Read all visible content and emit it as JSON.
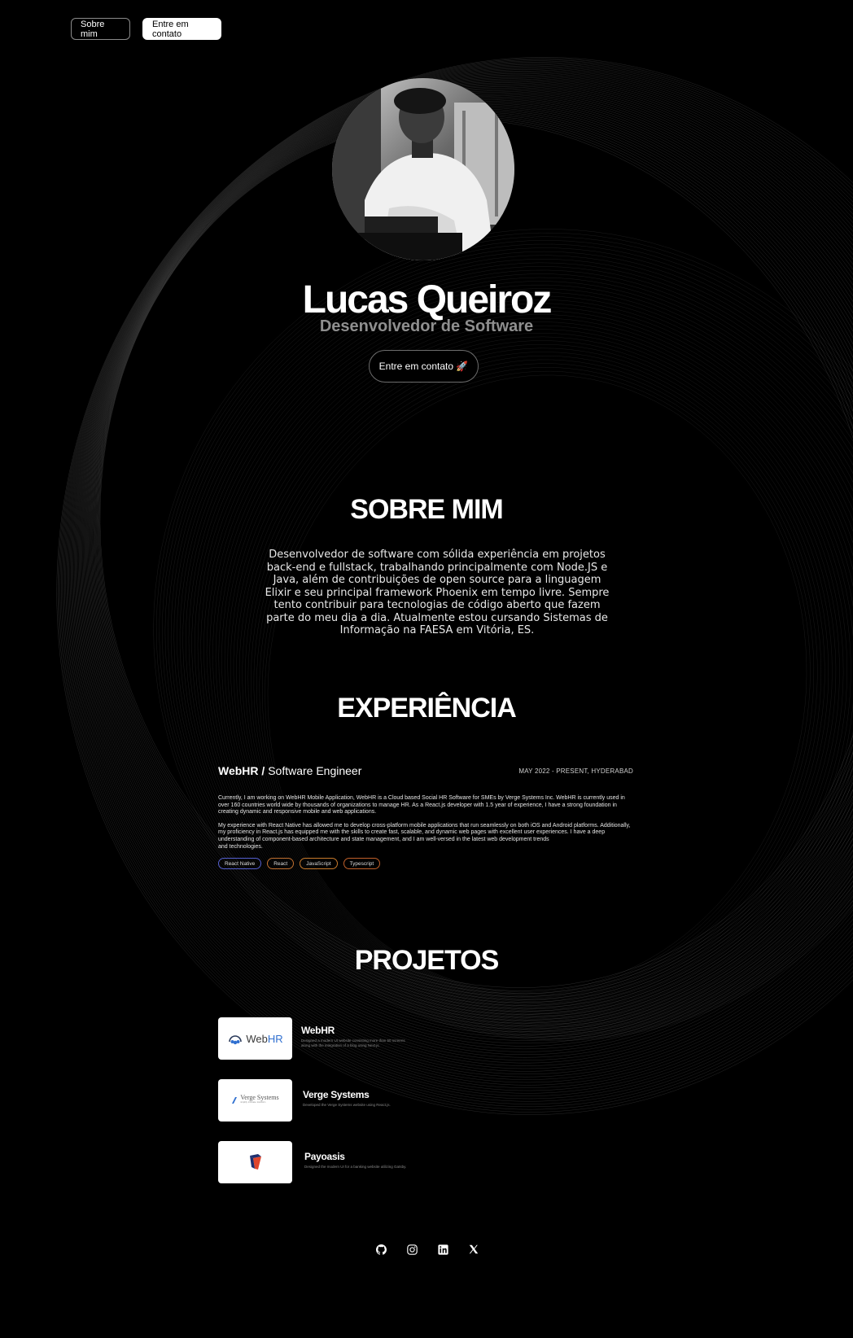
{
  "nav": {
    "about_label": "Sobre mim",
    "contact_label": "Entre em contato"
  },
  "hero": {
    "name": "Lucas Queiroz",
    "role": "Desenvolvedor de Software",
    "cta_label": "Entre em contato 🚀"
  },
  "about": {
    "title": "SOBRE MIM",
    "text": "Desenvolvedor de software com sólida experiência em projetos back-end e fullstack, trabalhando principalmente com Node.JS e Java, além de contribuições de open source para a linguagem Elixir e seu principal framework Phoenix em tempo livre. Sempre tento contribuir para tecnologias de código aberto que fazem parte do meu dia a dia. Atualmente estou cursando Sistemas de Informação na FAESA em Vitória, ES."
  },
  "experience": {
    "title": "EXPERIÊNCIA",
    "company": "WebHR /",
    "position": " Software Engineer",
    "date": "MAY 2022 - PRESENT, HYDERABAD",
    "paragraph1": "Currently, I am working on WebHR Mobile Application, WebHR is a Cloud based Social HR Software for SMEs by Verge Systems Inc. WebHR is currently used in over 160 countries world wide by thousands of organizations to manage HR. As a React.js developer with 1.5 year of experience, I have a strong foundation in creating dynamic and responsive mobile and web applications.",
    "paragraph2": "My experience with React Native has allowed me to develop cross-platform mobile applications that run seamlessly on both iOS and Android platforms. Additionally, my proficiency in React.js has equipped me with the skills to create fast, scalable, and dynamic web pages with excellent user experiences. I have a deep understanding of component-based architecture and state management, and I am well-versed in the latest web development trends",
    "paragraph2_tail": "and technologies.",
    "tags": [
      "React Native",
      "React",
      "JavaScript",
      "Typescript"
    ]
  },
  "projects": {
    "title": "PROJETOS",
    "items": [
      {
        "name": "WebHR",
        "desc": "Designed a modern UI website consisting more than 50 screens along with the integration of a blog using Next.js.",
        "logo_text_web": "Web",
        "logo_text_hr": "HR"
      },
      {
        "name": "Verge Systems",
        "desc": "Developed the Verge Systems website using React.js.",
        "logo_text": "Verge Systems",
        "logo_sub": "simplify. innovate. transform"
      },
      {
        "name": "Payoasis",
        "desc": "Designed the modern UI for a banking website utilizing Gatsby."
      }
    ]
  },
  "socials": {
    "icons": [
      "github-icon",
      "instagram-icon",
      "linkedin-icon",
      "x-icon"
    ]
  },
  "colors": {
    "background": "#000000",
    "text": "#ffffff",
    "muted": "#8f8f8f"
  }
}
